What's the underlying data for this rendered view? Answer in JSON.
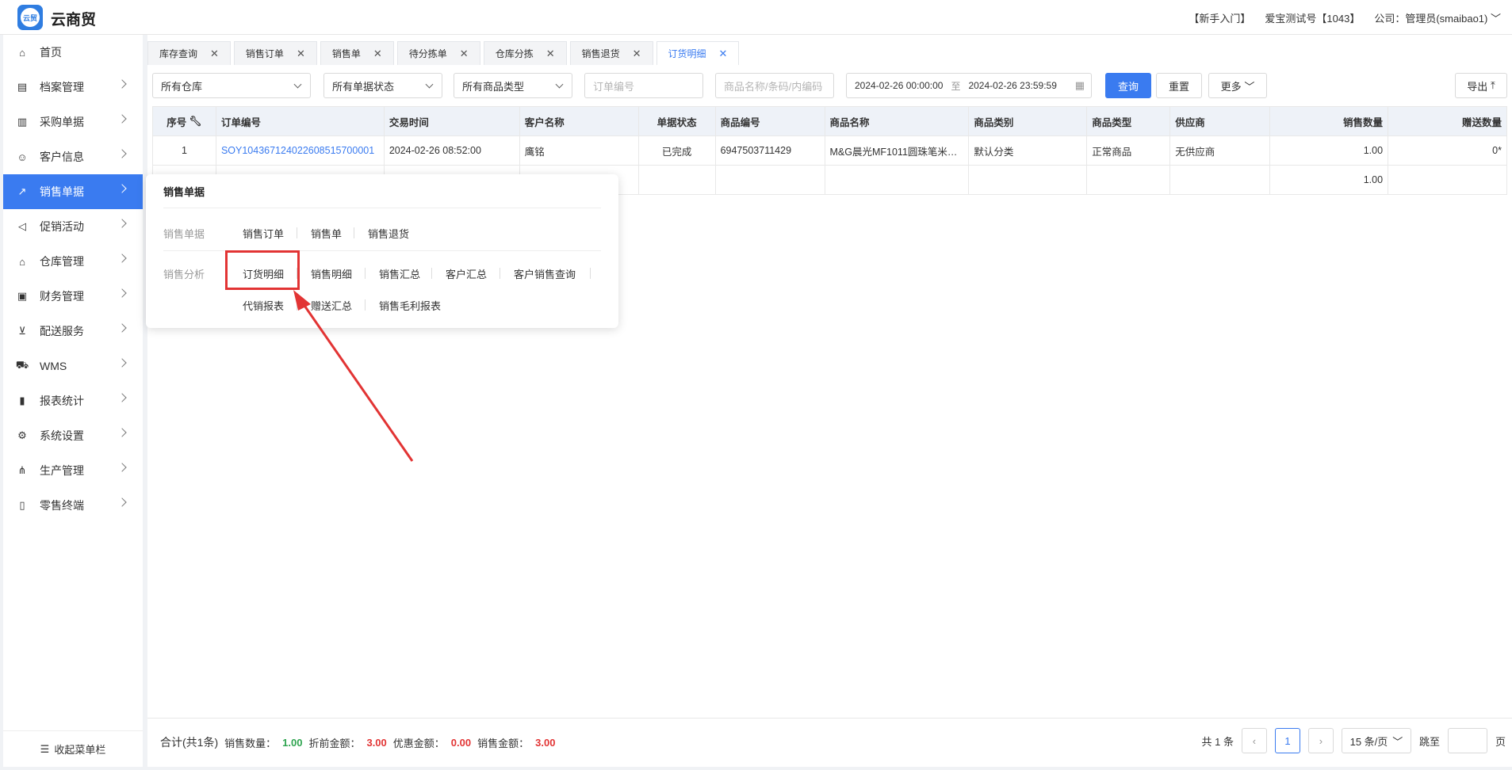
{
  "app": {
    "logo_text": "云贸",
    "brand": "云商贸"
  },
  "topbar": {
    "guide": "【新手入门】",
    "account": "爱宝测试号【1043】",
    "company": "公司：管理员(smaibao1)"
  },
  "sidebar": {
    "items": [
      {
        "label": "首页",
        "icon": "home-icon"
      },
      {
        "label": "档案管理",
        "icon": "archive-icon"
      },
      {
        "label": "采购单据",
        "icon": "document-icon"
      },
      {
        "label": "客户信息",
        "icon": "user-icon"
      },
      {
        "label": "销售单据",
        "icon": "chart-icon"
      },
      {
        "label": "促销活动",
        "icon": "megaphone-icon"
      },
      {
        "label": "仓库管理",
        "icon": "warehouse-icon"
      },
      {
        "label": "财务管理",
        "icon": "finance-icon"
      },
      {
        "label": "配送服务",
        "icon": "cart-icon"
      },
      {
        "label": "WMS",
        "icon": "truck-icon"
      },
      {
        "label": "报表统计",
        "icon": "report-icon"
      },
      {
        "label": "系统设置",
        "icon": "gear-icon"
      },
      {
        "label": "生产管理",
        "icon": "network-icon"
      },
      {
        "label": "零售终端",
        "icon": "bag-icon"
      }
    ],
    "collapse_label": "收起菜单栏"
  },
  "tabs": [
    {
      "label": "库存查询"
    },
    {
      "label": "销售订单"
    },
    {
      "label": "销售单"
    },
    {
      "label": "待分拣单"
    },
    {
      "label": "仓库分拣"
    },
    {
      "label": "销售退货"
    },
    {
      "label": "订货明细"
    }
  ],
  "filters": {
    "warehouse": "所有仓库",
    "status": "所有单据状态",
    "product_type": "所有商品类型",
    "order_no_placeholder": "订单编号",
    "product_placeholder": "商品名称/条码/内编码",
    "date_from": "2024-02-26 00:00:00",
    "date_sep": "至",
    "date_to": "2024-02-26 23:59:59",
    "query": "查询",
    "reset": "重置",
    "more": "更多",
    "export": "导出"
  },
  "table": {
    "headers": [
      "序号",
      "订单编号",
      "交易时间",
      "客户名称",
      "单据状态",
      "商品编号",
      "商品名称",
      "商品类别",
      "商品类型",
      "供应商",
      "销售数量",
      "赠送数量"
    ],
    "rows": [
      [
        "1",
        "SOY104367124022608515700001",
        "2024-02-26 08:52:00",
        "鹰铭",
        "已完成",
        "6947503711429",
        "M&G晨光MF1011圆珠笔米…",
        "默认分类",
        "正常商品",
        "无供应商",
        "1.00",
        "0*"
      ]
    ],
    "total_row": [
      "",
      "",
      "",
      "",
      "",
      "",
      "",
      "",
      "",
      "",
      "1.00",
      ""
    ]
  },
  "popup": {
    "title": "销售单据",
    "row1_label": "销售单据",
    "row1_links": [
      "销售订单",
      "销售单",
      "销售退货"
    ],
    "row2_label": "销售分析",
    "row2_links": [
      "订货明细",
      "销售明细",
      "销售汇总",
      "客户汇总",
      "客户销售查询"
    ],
    "row3_links": [
      "代销报表",
      "赠送汇总",
      "销售毛利报表"
    ]
  },
  "footer": {
    "total_label": "合计(共1条)",
    "qty_label": "销售数量：",
    "qty": "1.00",
    "pre_label": "折前金额：",
    "pre": "3.00",
    "disc_label": "优惠金额：",
    "disc": "0.00",
    "amt_label": "销售金额：",
    "amt": "3.00",
    "count": "共 1 条",
    "page": "1",
    "page_size": "15 条/页",
    "jump": "跳至",
    "page_unit": "页"
  },
  "colors": {
    "accent": "#3a7bf0",
    "highlight": "#e23434",
    "green": "#2ea44f"
  }
}
